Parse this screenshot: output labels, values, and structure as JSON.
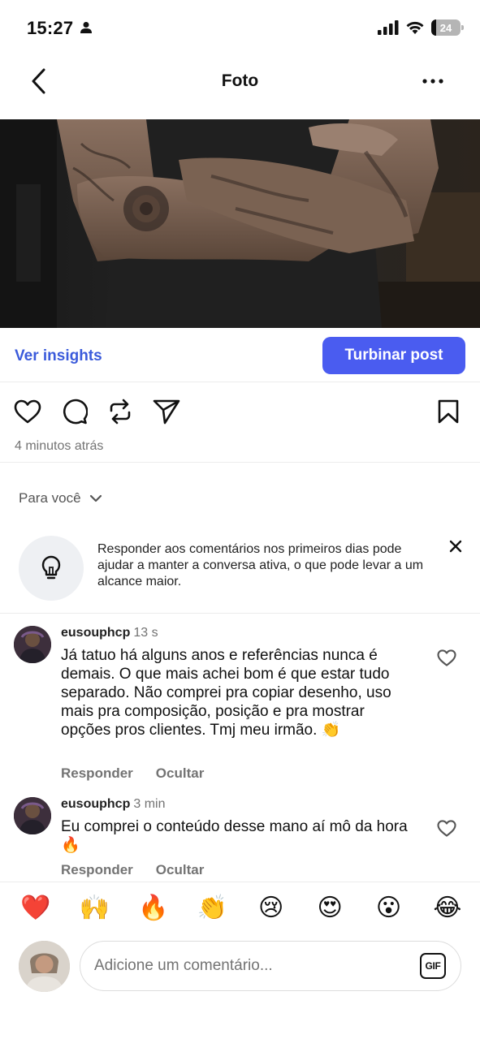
{
  "status_bar": {
    "time": "15:27",
    "battery": "24"
  },
  "nav": {
    "title": "Foto"
  },
  "post": {
    "insights_label": "Ver insights",
    "boost_label": "Turbinar post",
    "timestamp": "4 minutos atrás"
  },
  "sort": {
    "label": "Para você"
  },
  "tip": {
    "text": "Responder aos comentários nos primeiros dias pode ajudar a manter a conversa ativa, o que pode levar a um alcance maior."
  },
  "comments": [
    {
      "username": "eusouphcp",
      "time": "13 s",
      "text": "Já tatuo há alguns anos e referências nunca é demais. O que mais achei bom é que estar tudo separado. Não comprei pra copiar desenho, uso mais pra composição, posição e pra mostrar opções pros clientes. Tmj meu irmão. 👏",
      "reply_label": "Responder",
      "hide_label": "Ocultar"
    },
    {
      "username": "eusouphcp",
      "time": "3 min",
      "text": "Eu comprei o conteúdo desse mano aí mô da hora 🔥",
      "reply_label": "Responder",
      "hide_label": "Ocultar"
    }
  ],
  "emoji_bar": [
    "❤️",
    "🙌",
    "🔥",
    "👏",
    "😢",
    "😍",
    "😮",
    "😂"
  ],
  "composer": {
    "placeholder": "Adicione um comentário...",
    "gif_label": "GIF"
  },
  "colors": {
    "accent": "#4a5cf0",
    "link": "#3b5bdb",
    "muted_text": "#737373"
  }
}
